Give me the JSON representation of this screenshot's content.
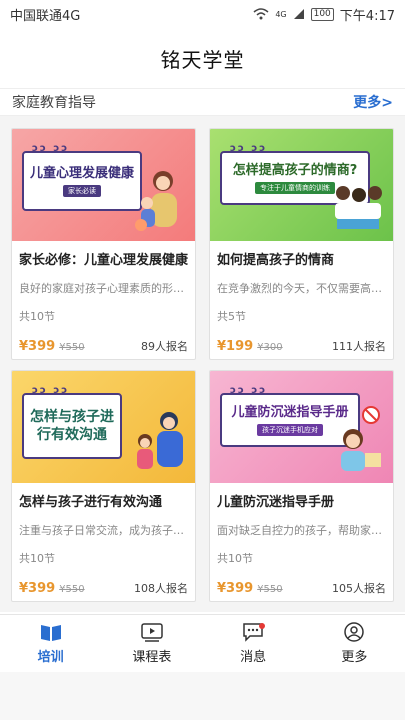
{
  "status": {
    "carrier": "中国联通4G",
    "network": "4G",
    "battery": "100",
    "time": "下午4:17"
  },
  "app": {
    "title": "铭天学堂"
  },
  "section": {
    "title": "家庭教育指导",
    "more": "更多>"
  },
  "courses": [
    {
      "cover_title": "儿童心理发展健康",
      "cover_sub": "家长必读",
      "name": "家长必修：儿童心理发展健康",
      "desc": "良好的家庭对孩子心理素质的形成...",
      "lessons": "共10节",
      "price": "¥399",
      "orig": "¥550",
      "enroll": "89人报名",
      "theme": "#f47b7b"
    },
    {
      "cover_title": "怎样提高孩子的情商?",
      "cover_sub": "专注于儿童情商的训练",
      "name": "如何提高孩子的情商",
      "desc": "在竞争激烈的今天，不仅需要高智...",
      "lessons": "共5节",
      "price": "¥199",
      "orig": "¥300",
      "enroll": "111人报名",
      "theme": "#8fd14f"
    },
    {
      "cover_title": "怎样与孩子进行有效沟通",
      "cover_sub": "",
      "name": "怎样与孩子进行有效沟通",
      "desc": "注重与孩子日常交流，成为孩子的...",
      "lessons": "共10节",
      "price": "¥399",
      "orig": "¥550",
      "enroll": "108人报名",
      "theme": "#f6c64a"
    },
    {
      "cover_title": "儿童防沉迷指导手册",
      "cover_sub": "孩子沉迷手机应对",
      "name": "儿童防沉迷指导手册",
      "desc": "面对缺乏自控力的孩子，帮助家长...",
      "lessons": "共10节",
      "price": "¥399",
      "orig": "¥550",
      "enroll": "105人报名",
      "theme": "#f49ac1"
    }
  ],
  "tabs": [
    {
      "label": "培训",
      "icon": "book-icon",
      "active": true
    },
    {
      "label": "课程表",
      "icon": "video-icon",
      "active": false
    },
    {
      "label": "消息",
      "icon": "message-icon",
      "active": false
    },
    {
      "label": "更多",
      "icon": "user-icon",
      "active": false
    }
  ]
}
